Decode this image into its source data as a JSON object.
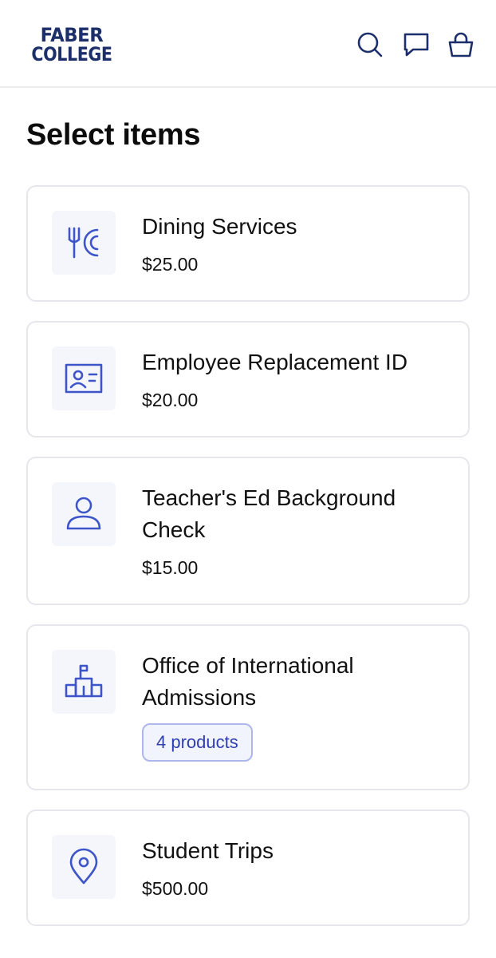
{
  "header": {
    "logo_line1": "FABER",
    "logo_line2": "COLLEGE",
    "icons": [
      "search-icon",
      "chat-icon",
      "cart-icon"
    ]
  },
  "page": {
    "title": "Select items"
  },
  "items": [
    {
      "name": "Dining Services",
      "price": "$25.00",
      "icon": "dining-icon"
    },
    {
      "name": "Employee Replacement ID",
      "price": "$20.00",
      "icon": "id-card-icon"
    },
    {
      "name": "Teacher's Ed Background Check",
      "price": "$15.00",
      "icon": "person-icon"
    },
    {
      "name": "Office of International Admissions",
      "badge": "4 products",
      "icon": "building-icon"
    },
    {
      "name": "Student Trips",
      "price": "$500.00",
      "icon": "location-pin-icon"
    }
  ],
  "colors": {
    "brand": "#1d2f6b",
    "accent": "#3e55c9",
    "thumb_bg": "#f4f6fc",
    "badge_bg": "#f1f3fd",
    "badge_border": "#aeb7ec",
    "card_border": "#e6e7ec"
  }
}
